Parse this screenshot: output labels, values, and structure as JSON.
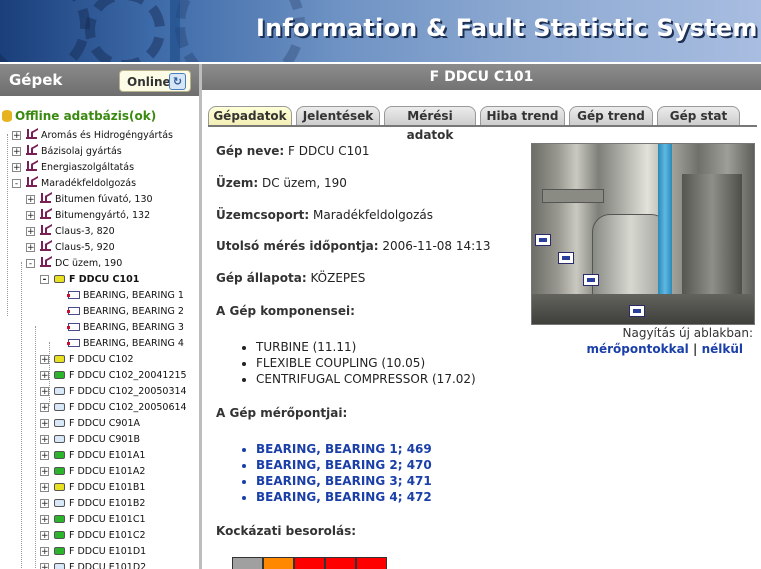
{
  "header": {
    "title": "Information & Fault Statistic System"
  },
  "left_panel": {
    "title": "Gépek",
    "online_button": "Online",
    "root": "Offline adatbázis(ok)",
    "tree": [
      {
        "label": "Aromás és Hidrogéngyártás",
        "toggle": "+",
        "kind": "fac",
        "level": 1
      },
      {
        "label": "Bázisolaj gyártás",
        "toggle": "+",
        "kind": "fac",
        "level": 1
      },
      {
        "label": "Energiaszolgáltatás",
        "toggle": "+",
        "kind": "fac",
        "level": 1
      },
      {
        "label": "Maradékfeldolgozás",
        "toggle": "-",
        "kind": "fac",
        "level": 1
      },
      {
        "label": "Bitumen fúvató, 130",
        "toggle": "+",
        "kind": "fac",
        "level": 2
      },
      {
        "label": "Bitumengyártó, 132",
        "toggle": "+",
        "kind": "fac",
        "level": 2
      },
      {
        "label": "Claus-3, 820",
        "toggle": "+",
        "kind": "fac",
        "level": 2
      },
      {
        "label": "Claus-5, 920",
        "toggle": "+",
        "kind": "fac",
        "level": 2
      },
      {
        "label": "DC üzem, 190",
        "toggle": "-",
        "kind": "fac",
        "level": 2
      },
      {
        "label": "F DDCU C101",
        "toggle": "-",
        "kind": "mach",
        "color": "#e8e020",
        "level": 3,
        "selected": true
      },
      {
        "label": "BEARING, BEARING 1",
        "toggle": "",
        "kind": "pt",
        "level": 4
      },
      {
        "label": "BEARING, BEARING 2",
        "toggle": "",
        "kind": "pt",
        "level": 4
      },
      {
        "label": "BEARING, BEARING 3",
        "toggle": "",
        "kind": "pt",
        "level": 4
      },
      {
        "label": "BEARING, BEARING 4",
        "toggle": "",
        "kind": "pt",
        "level": 4
      },
      {
        "label": "F DDCU C102",
        "toggle": "+",
        "kind": "mach",
        "color": "#e8e020",
        "level": 3
      },
      {
        "label": "F DDCU C102_20041215",
        "toggle": "+",
        "kind": "mach",
        "color": "#2bb32b",
        "level": 3
      },
      {
        "label": "F DDCU C102_20050314",
        "toggle": "+",
        "kind": "mach",
        "color": "#d8e8f8",
        "level": 3
      },
      {
        "label": "F DDCU C102_20050614",
        "toggle": "+",
        "kind": "mach",
        "color": "#d8e8f8",
        "level": 3
      },
      {
        "label": "F DDCU C901A",
        "toggle": "+",
        "kind": "mach",
        "color": "#d8e8f8",
        "level": 3
      },
      {
        "label": "F DDCU C901B",
        "toggle": "+",
        "kind": "mach",
        "color": "#d8e8f8",
        "level": 3
      },
      {
        "label": "F DDCU E101A1",
        "toggle": "+",
        "kind": "mach",
        "color": "#2bb32b",
        "level": 3
      },
      {
        "label": "F DDCU E101A2",
        "toggle": "+",
        "kind": "mach",
        "color": "#2bb32b",
        "level": 3
      },
      {
        "label": "F DDCU E101B1",
        "toggle": "+",
        "kind": "mach",
        "color": "#e8e020",
        "level": 3
      },
      {
        "label": "F DDCU E101B2",
        "toggle": "+",
        "kind": "mach",
        "color": "#d8e8f8",
        "level": 3
      },
      {
        "label": "F DDCU E101C1",
        "toggle": "+",
        "kind": "mach",
        "color": "#2bb32b",
        "level": 3
      },
      {
        "label": "F DDCU E101C2",
        "toggle": "+",
        "kind": "mach",
        "color": "#2bb32b",
        "level": 3
      },
      {
        "label": "F DDCU E101D1",
        "toggle": "+",
        "kind": "mach",
        "color": "#2bb32b",
        "level": 3
      },
      {
        "label": "F DDCU E101D2",
        "toggle": "+",
        "kind": "mach",
        "color": "#d8e8f8",
        "level": 3
      }
    ]
  },
  "main": {
    "title": "F DDCU C101",
    "tabs": [
      {
        "label": "Gépadatok",
        "active": true
      },
      {
        "label": "Jelentések"
      },
      {
        "label": "Mérési adatok"
      },
      {
        "label": "Hiba trend"
      },
      {
        "label": "Gép trend"
      },
      {
        "label": "Gép stat"
      }
    ],
    "fields": {
      "name_label": "Gép neve:",
      "name_value": " F DDCU C101",
      "plant_label": "Üzem:",
      "plant_value": " DC üzem, 190",
      "group_label": "Üzemcsoport:",
      "group_value": " Maradékfeldolgozás",
      "last_label": "Utolsó mérés időpontja:",
      "last_value": " 2006-11-08 14:13",
      "state_label": "Gép állapota:",
      "state_value": " KÖZEPES"
    },
    "components_title": "A Gép komponensei:",
    "components": [
      "TURBINE (11.11)",
      "FLEXIBLE COUPLING (10.05)",
      "CENTRIFUGAL COMPRESSOR (17.02)"
    ],
    "points_title": "A Gép mérőpontjai:",
    "points": [
      "BEARING, BEARING 1; 469",
      "BEARING, BEARING 2; 470",
      "BEARING, BEARING 3; 471",
      "BEARING, BEARING 4; 472"
    ],
    "zoom_text": "Nagyítás új ablakban:",
    "zoom_with": "mérőpontokkal",
    "zoom_sep": "|",
    "zoom_without": "nélkül",
    "risk_title": "Kockázati besorolás:",
    "risk_colors": [
      "#a0a0a0",
      "#ff8800",
      "#ff0000",
      "#ff0000",
      "#ff0000"
    ]
  }
}
